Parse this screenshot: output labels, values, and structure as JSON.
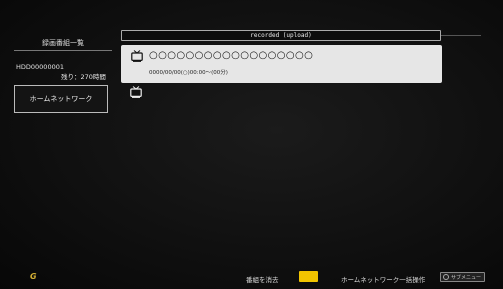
{
  "left_panel": {
    "title": "録画番組一覧",
    "device_id": "HDD00000001",
    "remaining": "残り：270時間",
    "home_network_button": "ホームネットワーク"
  },
  "header": {
    "title": "recorded (upload)"
  },
  "recordings": [
    {
      "title": "○○○○○○○○○○○○○○○○○○",
      "datetime": "0000/00/00(○)00:00〜(00分)",
      "icon": "tv-icon"
    }
  ],
  "footer": {
    "logo_text": "G",
    "delete_label": "番組を消去",
    "bulk_label": "ホームネットワーク一括操作",
    "submenu_label": "サブメニュー",
    "yellow_key_color": "#f2c400"
  }
}
